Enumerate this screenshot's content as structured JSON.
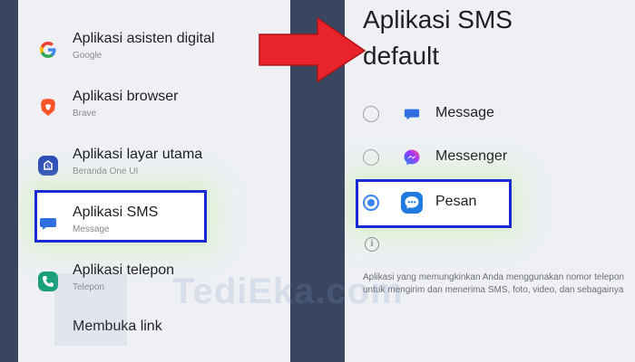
{
  "left_list": {
    "items": [
      {
        "title": "Aplikasi asisten digital",
        "subtitle": "Google",
        "icon": "google-icon"
      },
      {
        "title": "Aplikasi browser",
        "subtitle": "Brave",
        "icon": "brave-icon"
      },
      {
        "title": "Aplikasi layar utama",
        "subtitle": "Beranda One UI",
        "icon": "one-ui-home-icon"
      },
      {
        "title": "Aplikasi SMS",
        "subtitle": "Message",
        "icon": "message-icon"
      },
      {
        "title": "Aplikasi telepon",
        "subtitle": "Telepon",
        "icon": "phone-app-icon"
      },
      {
        "title": "Membuka link",
        "subtitle": ""
      }
    ]
  },
  "right_panel": {
    "title_line1": "Aplikasi SMS",
    "title_line2": "default",
    "options": [
      {
        "label": "Message",
        "selected": false,
        "icon": "message-icon"
      },
      {
        "label": "Messenger",
        "selected": false,
        "icon": "messenger-icon"
      },
      {
        "label": "Pesan",
        "selected": true,
        "icon": "samsung-messages-icon"
      }
    ],
    "description": "Aplikasi yang memungkinkan Anda menggunakan nomor telepon untuk mengirim dan menerima SMS, foto, video, dan sebagainya"
  },
  "watermark": "TediEka.com",
  "colors": {
    "highlight_border": "#1a2bd6",
    "arrow": "#e8242a",
    "radio_selected": "#3b82f6",
    "background": "#3a4660",
    "panel": "#eef0f3"
  }
}
